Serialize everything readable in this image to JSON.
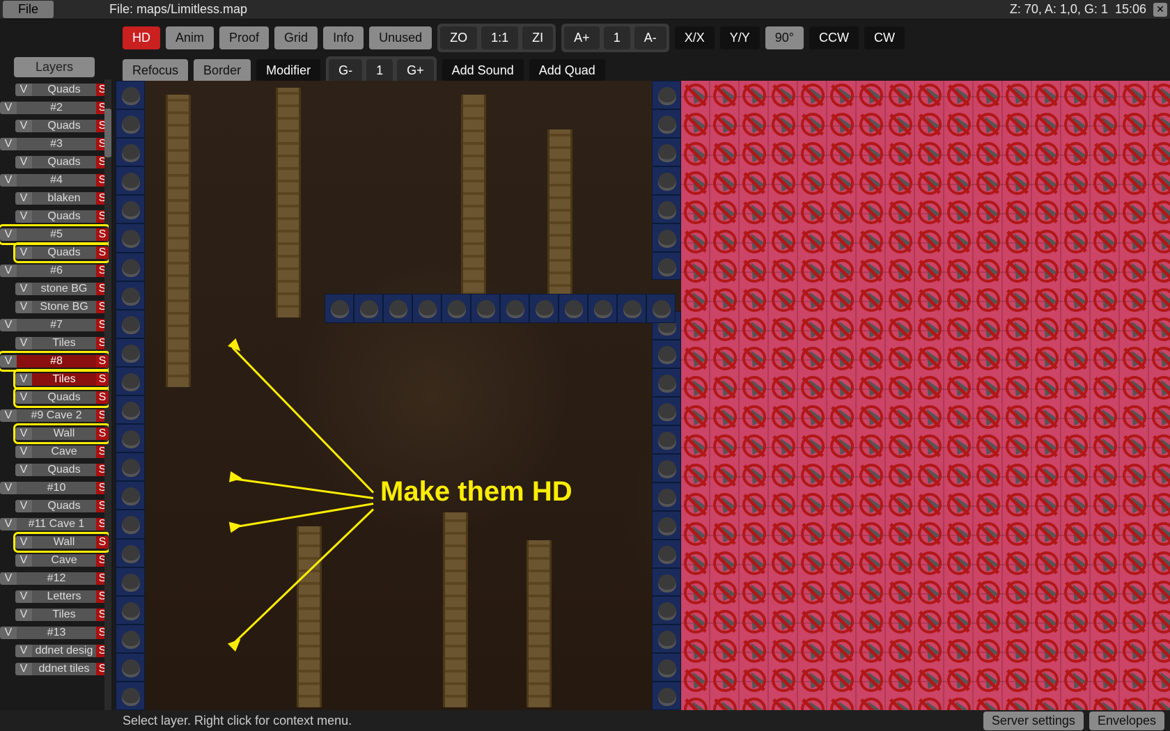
{
  "topbar": {
    "file_button": "File",
    "file_label": "File: maps/Limitless.map",
    "status": "Z: 70, A: 1,0, G: 1",
    "time": "15:06"
  },
  "toolbar1": {
    "hd": "HD",
    "anim": "Anim",
    "proof": "Proof",
    "grid": "Grid",
    "info": "Info",
    "unused": "Unused",
    "zo": "ZO",
    "one": "1:1",
    "zi": "ZI",
    "aplus": "A+",
    "acount": "1",
    "aminus": "A-",
    "xx": "X/X",
    "yy": "Y/Y",
    "ninety": "90°",
    "ccw": "CCW",
    "cw": "CW"
  },
  "toolbar2": {
    "refocus": "Refocus",
    "border": "Border",
    "modifier": "Modifier",
    "gminus": "G-",
    "gcount": "1",
    "gplus": "G+",
    "addsound": "Add Sound",
    "addquad": "Add Quad"
  },
  "sidebar": {
    "layers_button": "Layers",
    "groups": [
      {
        "name": "Quads",
        "indent": 1,
        "red": false
      },
      {
        "name": "#2",
        "indent": 0,
        "red": false
      },
      {
        "name": "Quads",
        "indent": 1,
        "red": false
      },
      {
        "name": "#3",
        "indent": 0,
        "red": false
      },
      {
        "name": "Quads",
        "indent": 1,
        "red": false
      },
      {
        "name": "#4",
        "indent": 0,
        "red": false
      },
      {
        "name": "blaken",
        "indent": 1,
        "red": false
      },
      {
        "name": "Quads",
        "indent": 1,
        "red": false
      },
      {
        "name": "#5",
        "indent": 0,
        "red": false,
        "hl": true
      },
      {
        "name": "Quads",
        "indent": 1,
        "red": false,
        "hl": true
      },
      {
        "name": "#6",
        "indent": 0,
        "red": false
      },
      {
        "name": "stone BG",
        "indent": 1,
        "red": false
      },
      {
        "name": "Stone BG",
        "indent": 1,
        "red": false
      },
      {
        "name": "#7",
        "indent": 0,
        "red": false
      },
      {
        "name": "Tiles",
        "indent": 1,
        "red": false
      },
      {
        "name": "#8",
        "indent": 0,
        "red": true,
        "hl": true
      },
      {
        "name": "Tiles",
        "indent": 1,
        "red": true,
        "hl": true
      },
      {
        "name": "Quads",
        "indent": 1,
        "red": false,
        "hl": true
      },
      {
        "name": "#9 Cave 2",
        "indent": 0,
        "red": false
      },
      {
        "name": "Wall",
        "indent": 1,
        "red": false,
        "hl": true
      },
      {
        "name": "Cave",
        "indent": 1,
        "red": false
      },
      {
        "name": "Quads",
        "indent": 1,
        "red": false
      },
      {
        "name": "#10",
        "indent": 0,
        "red": false
      },
      {
        "name": "Quads",
        "indent": 1,
        "red": false
      },
      {
        "name": "#11 Cave 1",
        "indent": 0,
        "red": false
      },
      {
        "name": "Wall",
        "indent": 1,
        "red": false,
        "hl": true
      },
      {
        "name": "Cave",
        "indent": 1,
        "red": false
      },
      {
        "name": "#12",
        "indent": 0,
        "red": false
      },
      {
        "name": "Letters",
        "indent": 1,
        "red": false
      },
      {
        "name": "Tiles",
        "indent": 1,
        "red": false
      },
      {
        "name": "#13",
        "indent": 0,
        "red": false
      },
      {
        "name": "ddnet desig",
        "indent": 1,
        "red": false
      },
      {
        "name": "ddnet tiles",
        "indent": 1,
        "red": false
      }
    ]
  },
  "annotation": "Make them HD",
  "statusbar": {
    "hint": "Select layer. Right click for context menu.",
    "server_settings": "Server settings",
    "envelopes": "Envelopes"
  }
}
